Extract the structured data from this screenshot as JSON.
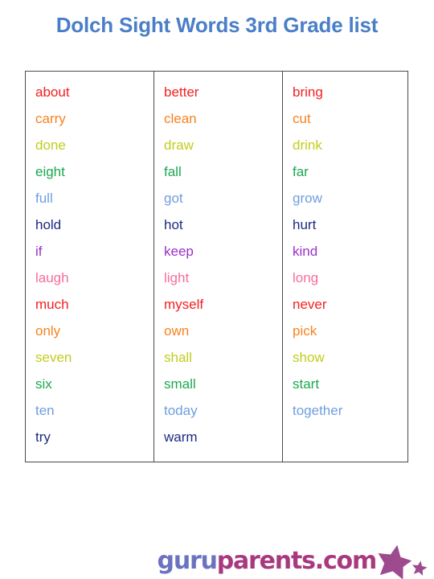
{
  "page": {
    "title": "Dolch Sight Words 3rd Grade list",
    "title_color": "#4a7fc8",
    "background": "#ffffff",
    "border_color": "#4a4a4a"
  },
  "palette": {
    "cycle": [
      "#f42020",
      "#f8821e",
      "#c2cc1e",
      "#1ba84f",
      "#6f9ede",
      "#1b2a80",
      "#9b30c9",
      "#f76b9e"
    ],
    "names": [
      "red",
      "orange",
      "yellow-green",
      "green",
      "light-blue",
      "navy",
      "purple",
      "pink"
    ]
  },
  "word_table": {
    "columns": [
      {
        "index": 0,
        "words": [
          {
            "text": "about",
            "color": "#f42020"
          },
          {
            "text": "carry",
            "color": "#f8821e"
          },
          {
            "text": "done",
            "color": "#c2cc1e"
          },
          {
            "text": "eight",
            "color": "#1ba84f"
          },
          {
            "text": "full",
            "color": "#6f9ede"
          },
          {
            "text": "hold",
            "color": "#1b2a80"
          },
          {
            "text": "if",
            "color": "#9b30c9"
          },
          {
            "text": "laugh",
            "color": "#f76b9e"
          },
          {
            "text": "much",
            "color": "#f42020"
          },
          {
            "text": "only",
            "color": "#f8821e"
          },
          {
            "text": "seven",
            "color": "#c2cc1e"
          },
          {
            "text": "six",
            "color": "#1ba84f"
          },
          {
            "text": "ten",
            "color": "#6f9ede"
          },
          {
            "text": "try",
            "color": "#1b2a80"
          }
        ]
      },
      {
        "index": 1,
        "words": [
          {
            "text": "better",
            "color": "#f42020"
          },
          {
            "text": "clean",
            "color": "#f8821e"
          },
          {
            "text": "draw",
            "color": "#c2cc1e"
          },
          {
            "text": "fall",
            "color": "#1ba84f"
          },
          {
            "text": "got",
            "color": "#6f9ede"
          },
          {
            "text": "hot",
            "color": "#1b2a80"
          },
          {
            "text": "keep",
            "color": "#9b30c9"
          },
          {
            "text": "light",
            "color": "#f76b9e"
          },
          {
            "text": "myself",
            "color": "#f42020"
          },
          {
            "text": "own",
            "color": "#f8821e"
          },
          {
            "text": "shall",
            "color": "#c2cc1e"
          },
          {
            "text": "small",
            "color": "#1ba84f"
          },
          {
            "text": "today",
            "color": "#6f9ede"
          },
          {
            "text": "warm",
            "color": "#1b2a80"
          }
        ]
      },
      {
        "index": 2,
        "words": [
          {
            "text": "bring",
            "color": "#f42020"
          },
          {
            "text": "cut",
            "color": "#f8821e"
          },
          {
            "text": "drink",
            "color": "#c2cc1e"
          },
          {
            "text": "far",
            "color": "#1ba84f"
          },
          {
            "text": "grow",
            "color": "#6f9ede"
          },
          {
            "text": "hurt",
            "color": "#1b2a80"
          },
          {
            "text": "kind",
            "color": "#9b30c9"
          },
          {
            "text": "long",
            "color": "#f76b9e"
          },
          {
            "text": "never",
            "color": "#f42020"
          },
          {
            "text": "pick",
            "color": "#f8821e"
          },
          {
            "text": "show",
            "color": "#c2cc1e"
          },
          {
            "text": "start",
            "color": "#1ba84f"
          },
          {
            "text": "together",
            "color": "#6f9ede"
          }
        ]
      }
    ]
  },
  "footer": {
    "logo_part1": "guru",
    "logo_part2": "parents.com",
    "logo_part1_color": "#6b72c0",
    "logo_part2_color": "#a8397f",
    "star_color": "#9d4a8f"
  }
}
